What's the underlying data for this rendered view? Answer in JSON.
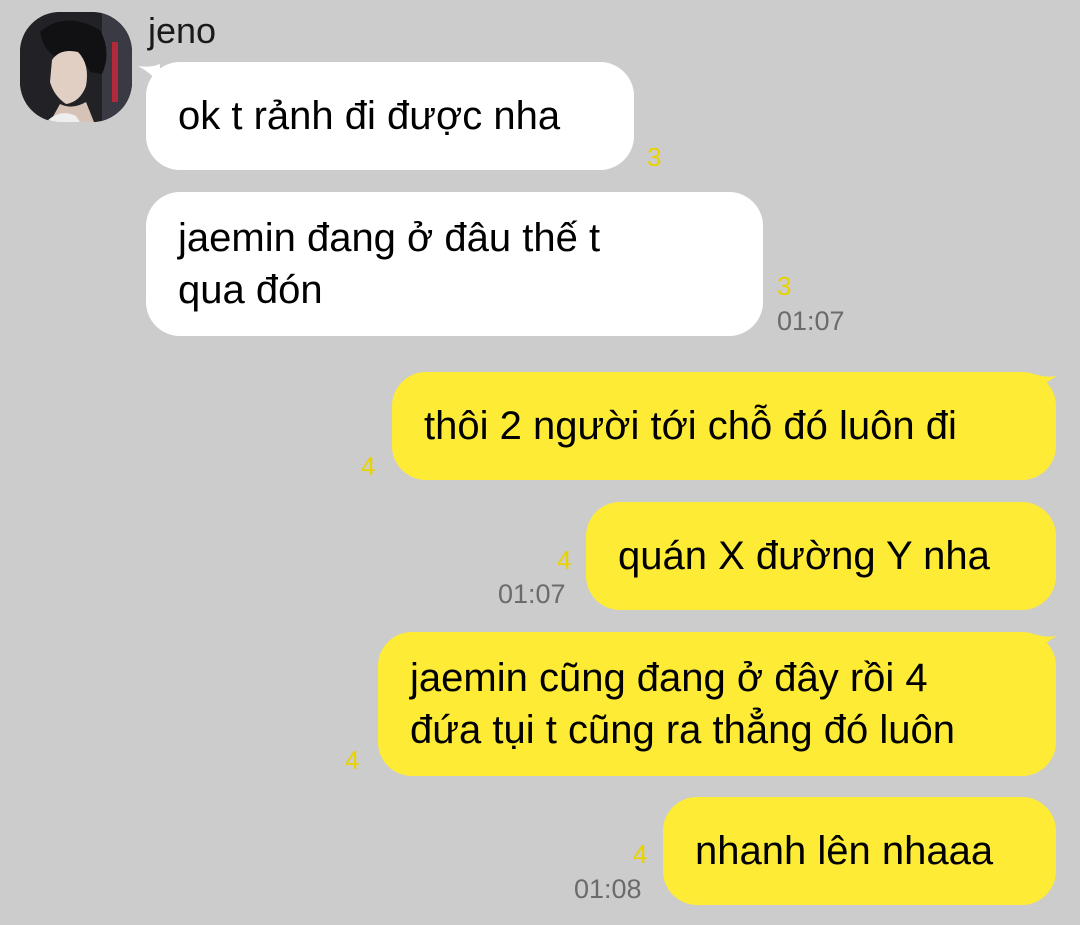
{
  "contact": {
    "name": "jeno"
  },
  "messages": [
    {
      "text": "ok t rảnh đi được nha",
      "unread": "3",
      "time": ""
    },
    {
      "lines": [
        "jaemin đang ở đâu thế t",
        "qua đón"
      ],
      "unread": "3",
      "time": "01:07"
    },
    {
      "text": "thôi 2 người tới chỗ đó luôn đi",
      "unread": "4",
      "time": ""
    },
    {
      "text": "quán X đường Y nha",
      "unread": "4",
      "time": "01:07"
    },
    {
      "lines": [
        "jaemin cũng đang ở đây rồi 4",
        "đứa tụi t cũng ra thẳng đó luôn"
      ],
      "unread": "4",
      "time": ""
    },
    {
      "text": "nhanh lên nhaaa",
      "unread": "4",
      "time": "01:08"
    }
  ],
  "colors": {
    "background": "#cccccc",
    "incoming_bubble": "#ffffff",
    "outgoing_bubble": "#feeb35",
    "unread_count": "#e8d200",
    "timestamp": "#6b6b6b"
  }
}
